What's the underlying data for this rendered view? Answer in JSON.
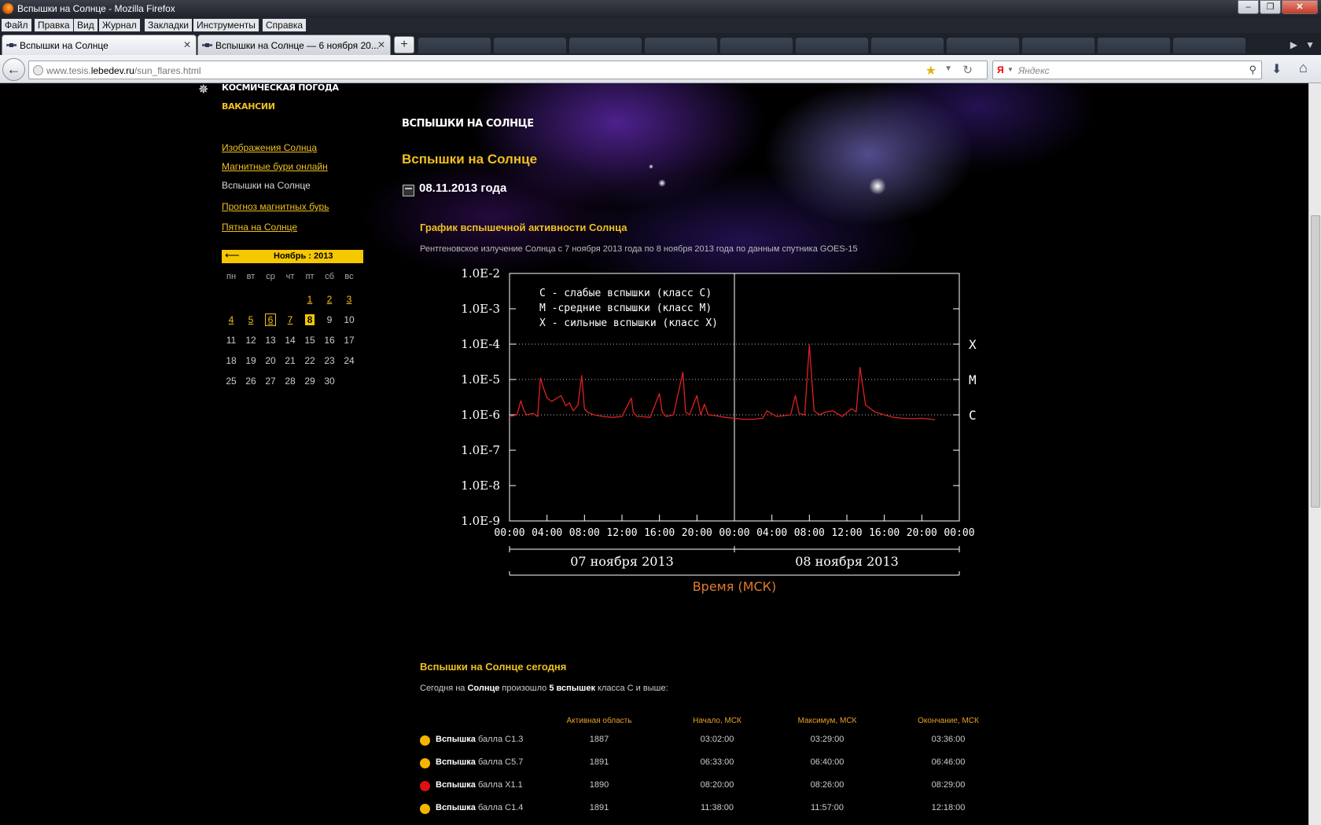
{
  "window": {
    "title": "Вспышки на Солнце - Mozilla Firefox"
  },
  "menu": [
    "Файл",
    "Правка",
    "Вид",
    "Журнал",
    "Закладки",
    "Инструменты",
    "Справка"
  ],
  "tabs": [
    {
      "label": "Вспышки на Солнце",
      "active": true
    },
    {
      "label": "Вспышки на Солнце — 6 ноября 20...",
      "active": false
    }
  ],
  "address": {
    "prefix": "www.tesis.",
    "domain": "lebedev.ru",
    "path": "/sun_flares.html"
  },
  "search": {
    "placeholder": "Яндекс",
    "engine_icon": "Я"
  },
  "site_nav": {
    "top_links": [
      "КОСМИЧЕСКАЯ ПОГОДА",
      "ВАКАНСИИ"
    ],
    "links": [
      {
        "label": "Изображения Солнца",
        "current": false
      },
      {
        "label": "Магнитные бури онлайн",
        "current": false
      },
      {
        "label": "Вспышки на Солнце",
        "current": true
      },
      {
        "label": "Прогноз магнитных бурь",
        "current": false
      },
      {
        "label": "Пятна на Солнце",
        "current": false
      }
    ]
  },
  "calendar": {
    "arrow": "⟵",
    "month": "Ноябрь : 2013",
    "weekdays": [
      "пн",
      "вт",
      "ср",
      "чт",
      "пт",
      "сб",
      "вс"
    ],
    "weeks": [
      [
        "",
        "",
        "",
        "",
        "1",
        "2",
        "3"
      ],
      [
        "4",
        "5",
        "6",
        "7",
        "8",
        "9",
        "10"
      ],
      [
        "11",
        "12",
        "13",
        "14",
        "15",
        "16",
        "17"
      ],
      [
        "18",
        "19",
        "20",
        "21",
        "22",
        "23",
        "24"
      ],
      [
        "25",
        "26",
        "27",
        "28",
        "29",
        "30",
        ""
      ]
    ],
    "linked_days": [
      "1",
      "2",
      "3",
      "4",
      "5",
      "6",
      "7"
    ],
    "boxed_day": "6",
    "today": "8"
  },
  "content": {
    "section_caps": "ВСПЫШКИ НА СОЛНЦЕ",
    "page_title": "Вспышки на Солнце",
    "date": "08.11.2013 года",
    "chart_heading": "График вспышечной активности Солнца",
    "chart_subtitle": "Рентгеновское излучение Солнца с 7 ноября 2013 года по 8 ноября 2013 года по данным спутника GOES-15",
    "today_heading": "Вспышки на Солнце сегодня",
    "today_sentence": {
      "a": "Сегодня на ",
      "b": "Солнце",
      "c": " произошло ",
      "d": "5 вспышек",
      "e": " класса С и выше:"
    }
  },
  "flares_table": {
    "columns": [
      "Активная область",
      "Начало, МСК",
      "Максимум, МСК",
      "Окончание, МСК"
    ],
    "word": "Вспышка",
    "rows": [
      {
        "grade": "балла C1.3",
        "region": "1887",
        "start": "03:02:00",
        "max": "03:29:00",
        "end": "03:36:00",
        "color": "#f5b400"
      },
      {
        "grade": "балла C5.7",
        "region": "1891",
        "start": "06:33:00",
        "max": "06:40:00",
        "end": "06:46:00",
        "color": "#f5b400"
      },
      {
        "grade": "балла X1.1",
        "region": "1890",
        "start": "08:20:00",
        "max": "08:26:00",
        "end": "08:29:00",
        "color": "#e01010"
      },
      {
        "grade": "балла C1.4",
        "region": "1891",
        "start": "11:38:00",
        "max": "11:57:00",
        "end": "12:18:00",
        "color": "#f5b400"
      }
    ]
  },
  "chart_data": {
    "type": "line",
    "yscale": "log",
    "ylim": [
      1e-09,
      0.01
    ],
    "y_ticks": [
      "1.0E-2",
      "1.0E-3",
      "1.0E-4",
      "1.0E-5",
      "1.0E-6",
      "1.0E-7",
      "1.0E-8",
      "1.0E-9"
    ],
    "x_ticks": [
      "00:00",
      "04:00",
      "08:00",
      "12:00",
      "16:00",
      "20:00",
      "00:00",
      "04:00",
      "08:00",
      "12:00",
      "16:00",
      "20:00",
      "00:00"
    ],
    "xlim_hours": [
      0,
      48
    ],
    "days": [
      "07 ноября 2013",
      "08 ноября 2013"
    ],
    "xlabel": "Время (МСК)",
    "class_labels": [
      {
        "label": "X",
        "value": 0.0001
      },
      {
        "label": "M",
        "value": 1e-05
      },
      {
        "label": "C",
        "value": 1e-06
      }
    ],
    "legend": [
      "C - слабые вспышки (класс C)",
      "M -средние вспышки (класс M)",
      "X - сильные вспышки (класс X)"
    ],
    "line_color": "#e02020",
    "series": [
      {
        "x_hours": [
          0,
          0.8,
          1.2,
          1.5,
          1.8,
          2.5,
          3.0,
          3.3,
          3.6,
          4.0,
          4.5,
          5.5,
          6.0,
          6.4,
          6.8,
          7.3,
          7.7,
          8.0,
          8.3,
          9.0,
          10.0,
          11.0,
          12.0,
          13.0,
          13.2,
          13.6,
          14.0,
          15.0,
          16.0,
          16.3,
          16.7,
          17.5,
          18.5,
          18.8,
          19.2,
          20.0,
          20.4,
          20.8,
          21.2,
          22.0,
          23.0,
          24.0,
          25.0,
          26.0,
          27.0,
          27.5,
          28.5,
          30.0,
          30.5,
          30.9,
          31.5,
          32.0,
          32.5,
          33.1,
          33.7,
          34.5,
          35.5,
          36.5,
          37.0,
          37.4,
          38.0,
          39.0,
          40.0,
          41.0,
          42.0,
          43.0,
          44.0,
          45.0,
          45.4
        ],
        "y": [
          9e-07,
          1e-06,
          2.5e-06,
          1.4e-06,
          1e-06,
          1.1e-06,
          9e-07,
          1.1e-05,
          6e-06,
          3e-06,
          2.4e-06,
          3.5e-06,
          1.8e-06,
          2.2e-06,
          1.3e-06,
          1.9e-06,
          1.3e-05,
          1.5e-06,
          1.2e-06,
          1e-06,
          9e-07,
          8.5e-07,
          9e-07,
          3e-06,
          1.2e-06,
          9e-07,
          9e-07,
          8.5e-07,
          4e-06,
          1.2e-06,
          9e-07,
          1e-06,
          1.6e-05,
          1.2e-06,
          1e-06,
          3.5e-06,
          1e-06,
          2e-06,
          1e-06,
          9.5e-07,
          8.5e-07,
          8e-07,
          7.5e-07,
          7.5e-07,
          8e-07,
          1.3e-06,
          9e-07,
          1e-06,
          3.5e-06,
          1.1e-06,
          1e-06,
          9.5e-05,
          1.3e-06,
          1e-06,
          1.2e-06,
          1.3e-06,
          9e-07,
          1.5e-06,
          1.2e-06,
          2.2e-05,
          1.9e-06,
          1.2e-06,
          1e-06,
          8.5e-07,
          8e-07,
          7.8e-07,
          8e-07,
          7.5e-07,
          7.2e-07
        ]
      }
    ]
  }
}
